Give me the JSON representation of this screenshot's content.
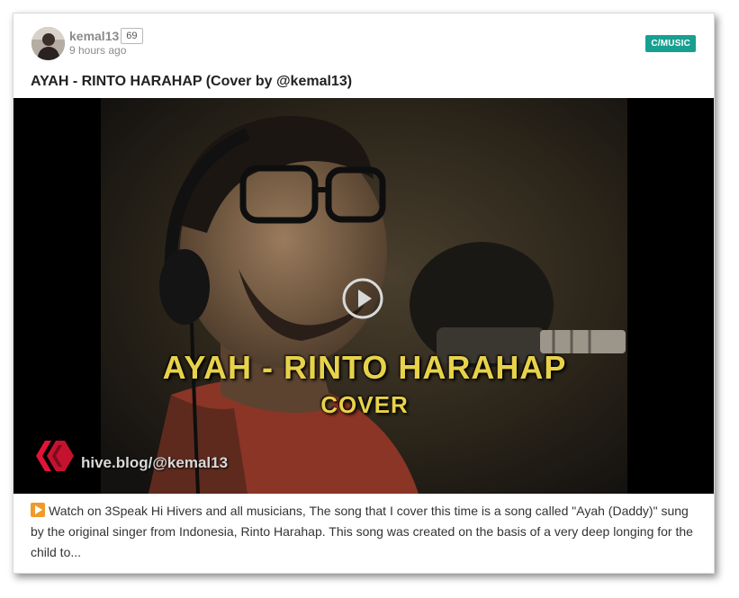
{
  "post": {
    "author": "kemal13",
    "reputation": "69",
    "timestamp": "9 hours ago",
    "community": "C/MUSIC",
    "title": "AYAH - RINTO HARAHAP (Cover by @kemal13)",
    "video": {
      "overlay_title": "AYAH - RINTO HARAHAP",
      "overlay_subtitle": "COVER",
      "watermark": "hive.blog/@kemal13",
      "play_icon": "play-circle-icon",
      "logo_icon": "hive-logo-icon"
    },
    "description_icon": "play-emoji-icon",
    "description": "Watch on 3Speak Hi Hivers and all musicians, The song that I cover this time is a song called \"Ayah (Daddy)\" sung by the original singer from Indonesia, Rinto Harahap. This song was created on the basis of a very deep longing for the child to..."
  },
  "colors": {
    "community_badge": "#17a091",
    "overlay_text": "#e8d24a",
    "hive_red": "#e31337"
  }
}
